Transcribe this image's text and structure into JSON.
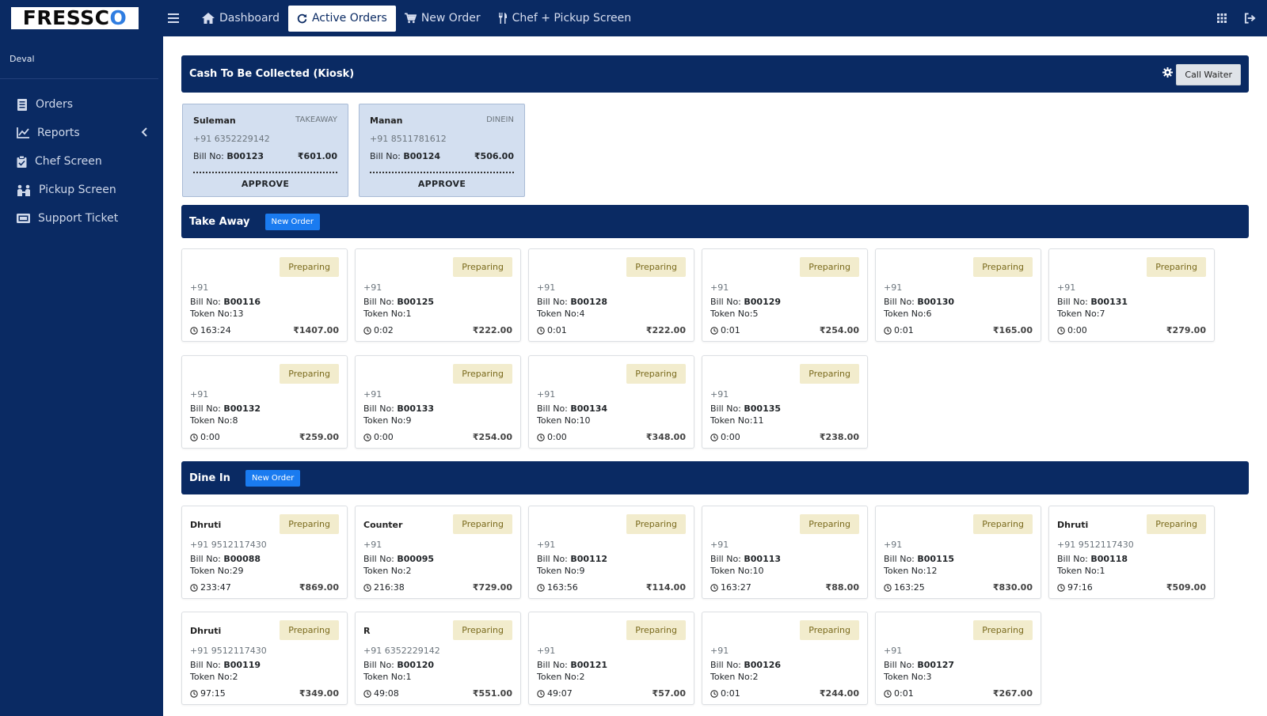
{
  "brand": {
    "logo_text_a": "FRESSC",
    "logo_text_b": "O"
  },
  "topnav": {
    "items": [
      {
        "label": "Dashboard",
        "icon": "home-icon",
        "active": false
      },
      {
        "label": "Active Orders",
        "icon": "refresh-icon",
        "active": true
      },
      {
        "label": "New Order",
        "icon": "cart-icon",
        "active": false
      },
      {
        "label": "Chef + Pickup Screen",
        "icon": "utensils-icon",
        "active": false
      }
    ]
  },
  "sidebar": {
    "user": "Deval",
    "items": [
      {
        "label": "Orders",
        "icon": "orders-icon"
      },
      {
        "label": "Reports",
        "icon": "chart-icon"
      },
      {
        "label": "Chef Screen",
        "icon": "clipboard-icon"
      },
      {
        "label": "Pickup Screen",
        "icon": "pickup-icon"
      },
      {
        "label": "Support Ticket",
        "icon": "ticket-icon"
      }
    ]
  },
  "kiosk": {
    "title": "Cash To Be Collected (Kiosk)",
    "call_waiter": "Call Waiter",
    "bill_label": "Bill No:",
    "approve_label": "APPROVE",
    "cards": [
      {
        "name": "Suleman",
        "type": "TAKEAWAY",
        "phone": "+91 6352229142",
        "bill": "B00123",
        "amount": "₹601.00"
      },
      {
        "name": "Manan",
        "type": "DINEIN",
        "phone": "+91 8511781612",
        "bill": "B00124",
        "amount": "₹506.00"
      }
    ]
  },
  "takeaway": {
    "title": "Take Away",
    "new_order": "New Order",
    "orders": [
      {
        "name": "",
        "status": "Preparing",
        "phone": "+91",
        "bill": "B00116",
        "token": "Token No:13",
        "time": "163:24",
        "amount": "₹1407.00"
      },
      {
        "name": "",
        "status": "Preparing",
        "phone": "+91",
        "bill": "B00125",
        "token": "Token No:1",
        "time": "0:02",
        "amount": "₹222.00"
      },
      {
        "name": "",
        "status": "Preparing",
        "phone": "+91",
        "bill": "B00128",
        "token": "Token No:4",
        "time": "0:01",
        "amount": "₹222.00"
      },
      {
        "name": "",
        "status": "Preparing",
        "phone": "+91",
        "bill": "B00129",
        "token": "Token No:5",
        "time": "0:01",
        "amount": "₹254.00"
      },
      {
        "name": "",
        "status": "Preparing",
        "phone": "+91",
        "bill": "B00130",
        "token": "Token No:6",
        "time": "0:01",
        "amount": "₹165.00"
      },
      {
        "name": "",
        "status": "Preparing",
        "phone": "+91",
        "bill": "B00131",
        "token": "Token No:7",
        "time": "0:00",
        "amount": "₹279.00"
      },
      {
        "name": "",
        "status": "Preparing",
        "phone": "+91",
        "bill": "B00132",
        "token": "Token No:8",
        "time": "0:00",
        "amount": "₹259.00"
      },
      {
        "name": "",
        "status": "Preparing",
        "phone": "+91",
        "bill": "B00133",
        "token": "Token No:9",
        "time": "0:00",
        "amount": "₹254.00"
      },
      {
        "name": "",
        "status": "Preparing",
        "phone": "+91",
        "bill": "B00134",
        "token": "Token No:10",
        "time": "0:00",
        "amount": "₹348.00"
      },
      {
        "name": "",
        "status": "Preparing",
        "phone": "+91",
        "bill": "B00135",
        "token": "Token No:11",
        "time": "0:00",
        "amount": "₹238.00"
      }
    ]
  },
  "dinein": {
    "title": "Dine In",
    "new_order": "New Order",
    "orders": [
      {
        "name": "Dhruti",
        "status": "Preparing",
        "phone": "+91 9512117430",
        "bill": "B00088",
        "token": "Token No:29",
        "time": "233:47",
        "amount": "₹869.00"
      },
      {
        "name": "Counter",
        "status": "Preparing",
        "phone": "+91",
        "bill": "B00095",
        "token": "Token No:2",
        "time": "216:38",
        "amount": "₹729.00"
      },
      {
        "name": "",
        "status": "Preparing",
        "phone": "+91",
        "bill": "B00112",
        "token": "Token No:9",
        "time": "163:56",
        "amount": "₹114.00"
      },
      {
        "name": "",
        "status": "Preparing",
        "phone": "+91",
        "bill": "B00113",
        "token": "Token No:10",
        "time": "163:27",
        "amount": "₹88.00"
      },
      {
        "name": "",
        "status": "Preparing",
        "phone": "+91",
        "bill": "B00115",
        "token": "Token No:12",
        "time": "163:25",
        "amount": "₹830.00"
      },
      {
        "name": "Dhruti",
        "status": "Preparing",
        "phone": "+91 9512117430",
        "bill": "B00118",
        "token": "Token No:1",
        "time": "97:16",
        "amount": "₹509.00"
      },
      {
        "name": "Dhruti",
        "status": "Preparing",
        "phone": "+91 9512117430",
        "bill": "B00119",
        "token": "Token No:2",
        "time": "97:15",
        "amount": "₹349.00"
      },
      {
        "name": "R",
        "status": "Preparing",
        "phone": "+91 6352229142",
        "bill": "B00120",
        "token": "Token No:1",
        "time": "49:08",
        "amount": "₹551.00"
      },
      {
        "name": "",
        "status": "Preparing",
        "phone": "+91",
        "bill": "B00121",
        "token": "Token No:2",
        "time": "49:07",
        "amount": "₹57.00"
      },
      {
        "name": "",
        "status": "Preparing",
        "phone": "+91",
        "bill": "B00126",
        "token": "Token No:2",
        "time": "0:01",
        "amount": "₹244.00"
      },
      {
        "name": "",
        "status": "Preparing",
        "phone": "+91",
        "bill": "B00127",
        "token": "Token No:3",
        "time": "0:01",
        "amount": "₹267.00"
      }
    ]
  },
  "labels": {
    "bill_label": "Bill No:"
  },
  "colors": {
    "navy": "#0a2a63",
    "accent": "#1a7bf0",
    "status_bg": "#f2eccd",
    "kiosk_bg": "#d3dff0"
  }
}
